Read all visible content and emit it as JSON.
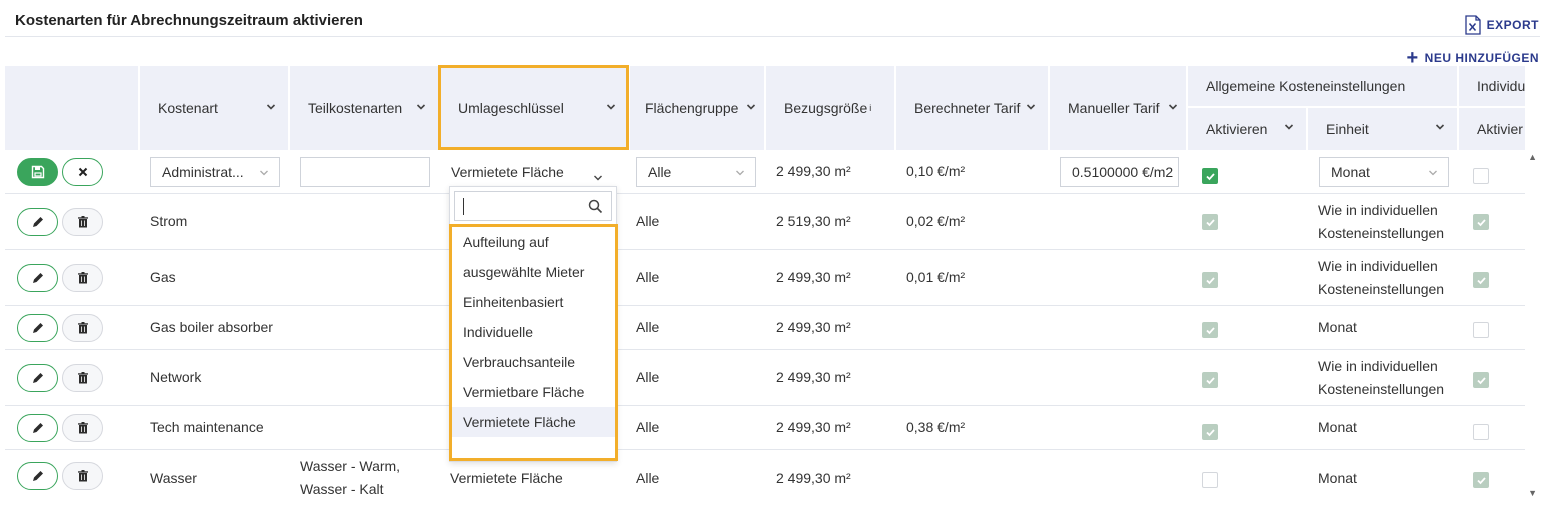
{
  "page": {
    "title": "Kostenarten für Abrechnungszeitraum aktivieren",
    "export_label": "EXPORT",
    "add_label": "NEU HINZUFÜGEN"
  },
  "colors": {
    "accent": "#2b3a8c",
    "green": "#3aa55c",
    "highlight": "#f2ae2a",
    "header_bg": "#eef0f8"
  },
  "columns": {
    "kostenart": "Kostenart",
    "teilkostenarten": "Teilkostenarten",
    "umlageschluessel": "Umlageschlüssel",
    "flaechengruppe": "Flächengruppe",
    "bezugsgroesse": "Bezugsgröße",
    "bezugsgroesse_sup": "i",
    "berechneter_tarif": "Berechneter Tarif",
    "manueller_tarif": "Manueller Tarif",
    "allgemeine_group": "Allgemeine Kosteneinstellungen",
    "allgemeine_aktivieren": "Aktivieren",
    "allgemeine_einheit": "Einheit",
    "individuelle_group": "Individu",
    "individuelle_aktivieren": "Aktivier"
  },
  "edit_row": {
    "kostenart_value": "Administrat...",
    "teilkostenarten_value": "",
    "umlageschluessel_value": "Vermietete Fläche",
    "flaechengruppe_value": "Alle",
    "bezugsgroesse": "2 499,30 m²",
    "berechneter_tarif": "0,10 €/m²",
    "manueller_tarif_value": "0.5100000 €/m2",
    "einheit_value": "Monat"
  },
  "rows": [
    {
      "kostenart": "Strom",
      "teilkostenarten": "",
      "umlageschluessel": "",
      "flaechengruppe": "Alle",
      "bezugsgroesse": "2 519,30 m²",
      "berechneter_tarif": "0,02 €/m²",
      "einheit_line1": "Wie in individuellen",
      "einheit_line2": "Kosteneinstellungen"
    },
    {
      "kostenart": "Gas",
      "teilkostenarten": "",
      "umlageschluessel": "",
      "flaechengruppe": "Alle",
      "bezugsgroesse": "2 499,30 m²",
      "berechneter_tarif": "0,01 €/m²",
      "einheit_line1": "Wie in individuellen",
      "einheit_line2": "Kosteneinstellungen"
    },
    {
      "kostenart": "Gas boiler absorber",
      "teilkostenarten": "",
      "umlageschluessel": "",
      "flaechengruppe": "Alle",
      "bezugsgroesse": "2 499,30 m²",
      "berechneter_tarif": "",
      "einheit_line1": "Monat",
      "einheit_line2": ""
    },
    {
      "kostenart": "Network",
      "teilkostenarten": "",
      "umlageschluessel": "",
      "flaechengruppe": "Alle",
      "bezugsgroesse": "2 499,30 m²",
      "berechneter_tarif": "",
      "einheit_line1": "Wie in individuellen",
      "einheit_line2": "Kosteneinstellungen"
    },
    {
      "kostenart": "Tech maintenance",
      "teilkostenarten": "",
      "umlageschluessel": "",
      "flaechengruppe": "Alle",
      "bezugsgroesse": "2 499,30 m²",
      "berechneter_tarif": "0,38 €/m²",
      "einheit_line1": "Monat",
      "einheit_line2": ""
    },
    {
      "kostenart": "Wasser",
      "teilkostenarten_line1": "Wasser - Warm,",
      "teilkostenarten_line2": "Wasser - Kalt",
      "umlageschluessel": "Vermietete Fläche",
      "flaechengruppe": "Alle",
      "bezugsgroesse": "2 499,30 m²",
      "berechneter_tarif": "",
      "einheit_line1": "Monat",
      "einheit_line2": ""
    }
  ],
  "dropdown": {
    "search_placeholder": "",
    "options": [
      {
        "line1": "Aufteilung auf",
        "line2": "ausgewählte Mieter"
      },
      {
        "line1": "Einheitenbasiert",
        "line2": ""
      },
      {
        "line1": "Individuelle",
        "line2": "Verbrauchsanteile"
      },
      {
        "line1": "Vermietbare Fläche",
        "line2": ""
      },
      {
        "line1": "Vermietete Fläche",
        "line2": "",
        "selected": true
      }
    ]
  }
}
